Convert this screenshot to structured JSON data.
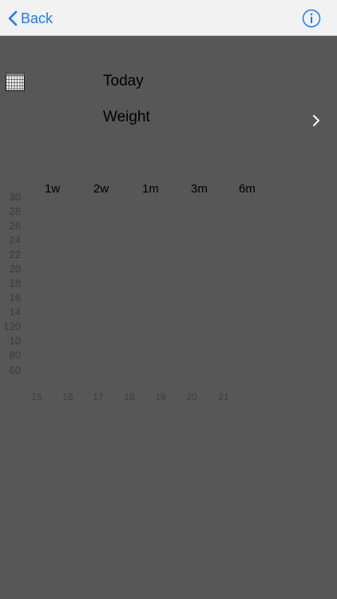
{
  "nav": {
    "back_label": "Back"
  },
  "header": {
    "today_label": "Today",
    "metric_label": "Weight"
  },
  "range_tabs": [
    "1w",
    "2w",
    "1m",
    "3m",
    "6m"
  ],
  "y_axis_ticks": [
    "30",
    "28",
    "26",
    "24",
    "22",
    "20",
    "18",
    "16",
    "14",
    "120",
    "10",
    "80",
    "60"
  ],
  "x_axis_ticks": [
    "15",
    "16",
    "17",
    "18",
    "19",
    "20",
    "21"
  ],
  "colors": {
    "accent": "#1a7cf6",
    "background": "#575757",
    "navbar": "#f2f2f2"
  }
}
